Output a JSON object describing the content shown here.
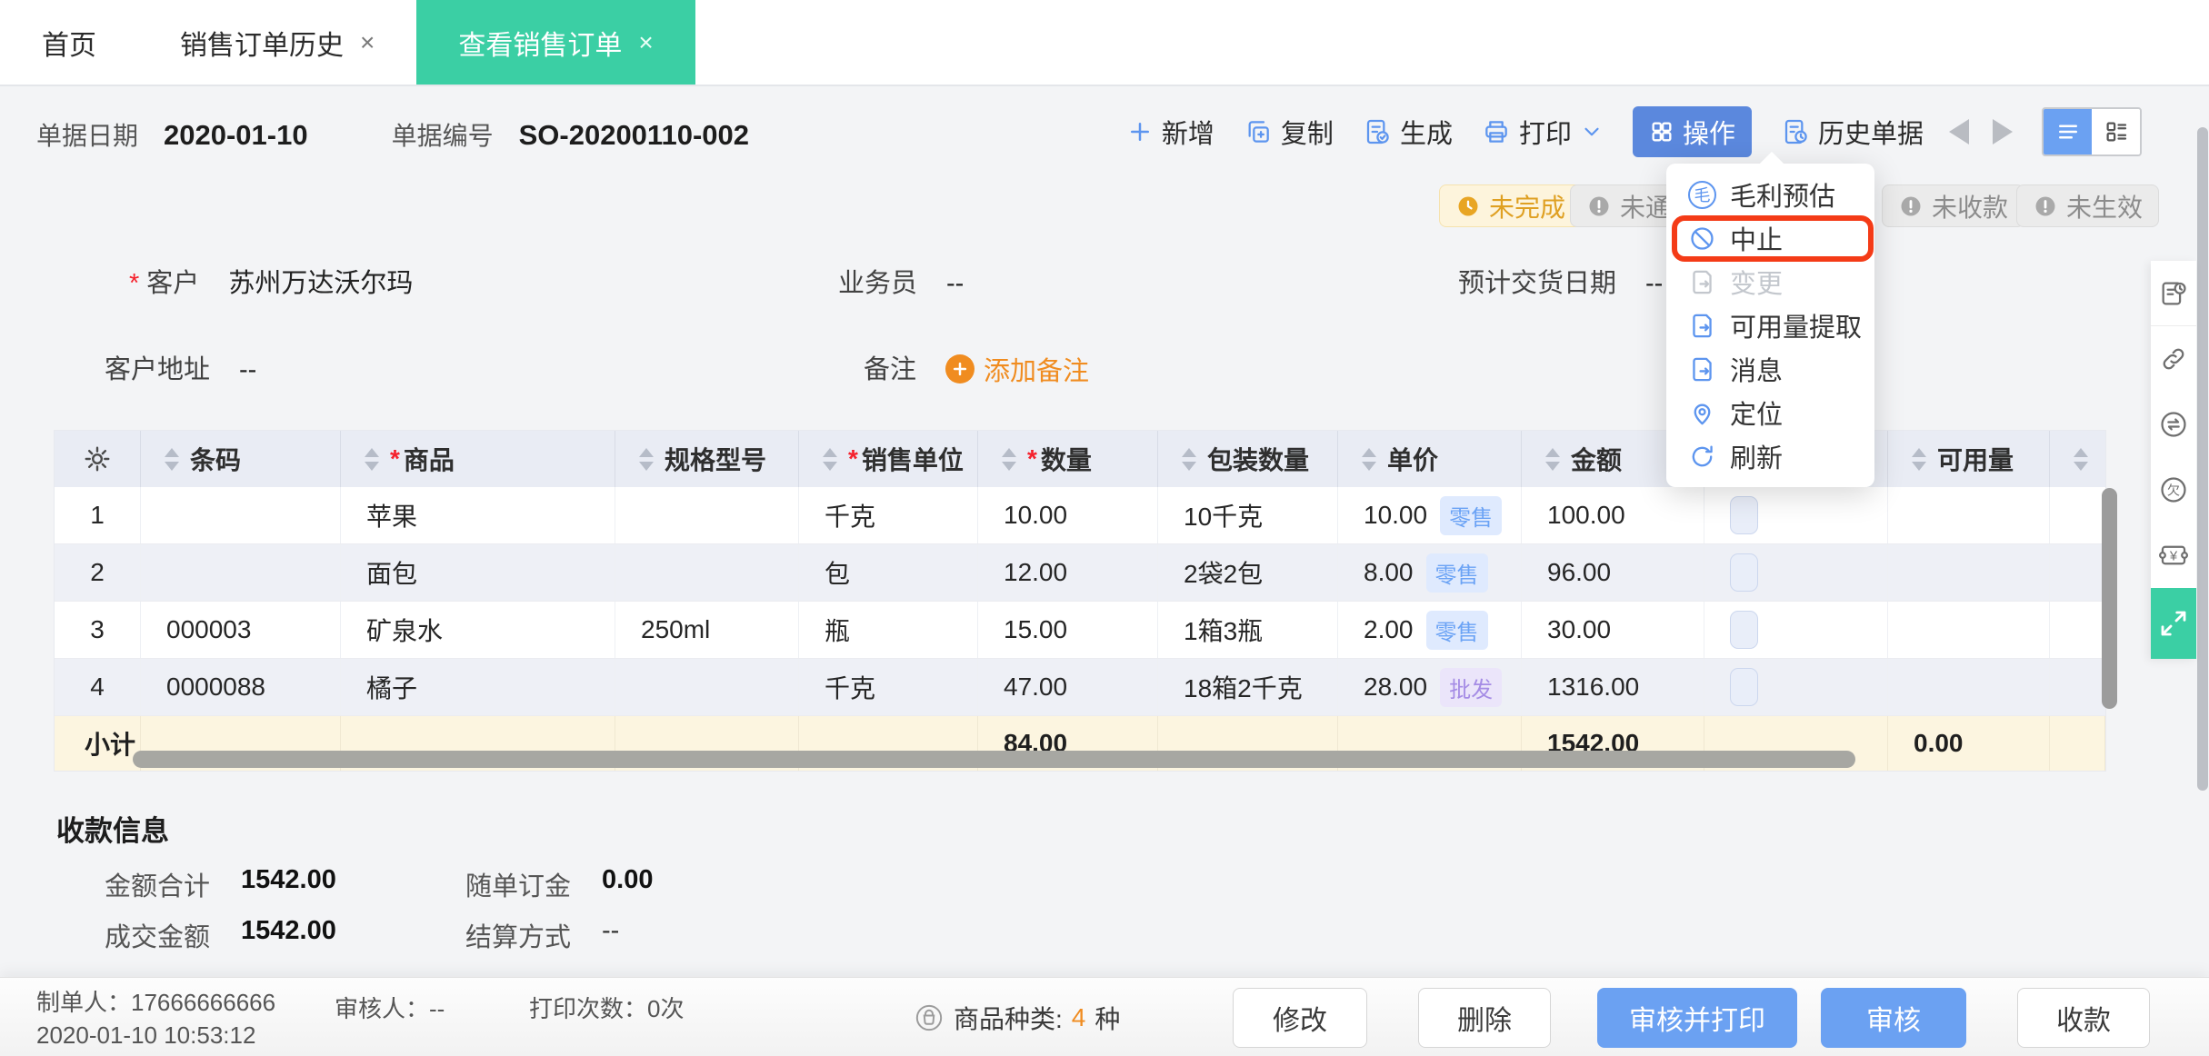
{
  "app": {
    "close_icon": "×"
  },
  "tabs": [
    {
      "label": "首页"
    },
    {
      "label": "销售订单历史",
      "close": "×"
    },
    {
      "label": "查看销售订单",
      "close": "×"
    }
  ],
  "doc": {
    "date_label": "单据日期",
    "date_value": "2020-01-10",
    "number_label": "单据编号",
    "number_value": "SO-20200110-002"
  },
  "toolbar": {
    "add": "新增",
    "copy": "复制",
    "generate": "生成",
    "print": "打印",
    "action": "操作",
    "history": "历史单据"
  },
  "badges": {
    "incomplete": "未完成",
    "unnotified": "未通知",
    "unpaid": "未收款",
    "ineffective": "未生效"
  },
  "action_menu": {
    "items": [
      {
        "label": "毛利预估",
        "icon_char": "毛"
      },
      {
        "label": "中止"
      },
      {
        "label": "变更"
      },
      {
        "label": "可用量提取"
      },
      {
        "label": "消息"
      },
      {
        "label": "定位"
      },
      {
        "label": "刷新"
      }
    ]
  },
  "form": {
    "required_marker": "*",
    "customer_label": "客户",
    "customer_value": "苏州万达沃尔玛",
    "salesman_label": "业务员",
    "salesman_value": "--",
    "delivery_label": "预计交货日期",
    "delivery_value": "--",
    "address_label": "客户地址",
    "address_value": "--",
    "remark_label": "备注",
    "add_remark_label": "添加备注"
  },
  "table": {
    "required_marker": "*",
    "columns": {
      "barcode": "条码",
      "product": "商品",
      "spec": "规格型号",
      "unit": "销售单位",
      "qty": "数量",
      "pack": "包装数量",
      "price": "单价",
      "amount": "金额",
      "available": "可用量"
    },
    "rows": [
      {
        "seq": "1",
        "barcode": "",
        "product": "苹果",
        "spec": "",
        "unit": "千克",
        "qty": "10.00",
        "pack": "10千克",
        "price": "10.00",
        "price_tag": "零售",
        "amount": "100.00",
        "available": ""
      },
      {
        "seq": "2",
        "barcode": "",
        "product": "面包",
        "spec": "",
        "unit": "包",
        "qty": "12.00",
        "pack": "2袋2包",
        "price": "8.00",
        "price_tag": "零售",
        "amount": "96.00",
        "available": ""
      },
      {
        "seq": "3",
        "barcode": "000003",
        "product": "矿泉水",
        "spec": "250ml",
        "unit": "瓶",
        "qty": "15.00",
        "pack": "1箱3瓶",
        "price": "2.00",
        "price_tag": "零售",
        "amount": "30.00",
        "available": ""
      },
      {
        "seq": "4",
        "barcode": "0000088",
        "product": "橘子",
        "spec": "",
        "unit": "千克",
        "qty": "47.00",
        "pack": "18箱2千克",
        "price": "28.00",
        "price_tag": "批发",
        "amount": "1316.00",
        "available": ""
      }
    ],
    "subtotal": {
      "label": "小计",
      "qty": "84.00",
      "amount": "1542.00",
      "available": "0.00"
    }
  },
  "payment": {
    "title": "收款信息",
    "total_label": "金额合计",
    "total_value": "1542.00",
    "deposit_label": "随单订金",
    "deposit_value": "0.00",
    "deal_label": "成交金额",
    "deal_value": "1542.00",
    "settle_label": "结算方式",
    "settle_value": "--"
  },
  "footer": {
    "creator_label": "制单人：",
    "creator_value": "17666666666",
    "created_at": "2020-01-10 10:53:12",
    "auditor_label": "审核人：",
    "auditor_value": "--",
    "print_label": "打印次数：",
    "print_value": "0次",
    "category_label": "商品种类:",
    "category_count": "4",
    "category_unit": "种",
    "buttons": {
      "modify": "修改",
      "delete": "删除",
      "audit_print": "审核并打印",
      "audit": "审核",
      "collect": "收款"
    }
  },
  "sidebar": {
    "owe_char": "欠",
    "yuan_char": "¥"
  },
  "colors": {
    "accent_teal": "#3bcfa4",
    "accent_blue": "#6ba1f2",
    "highlight_red": "#f43b17",
    "warn_orange": "#f08c20"
  }
}
